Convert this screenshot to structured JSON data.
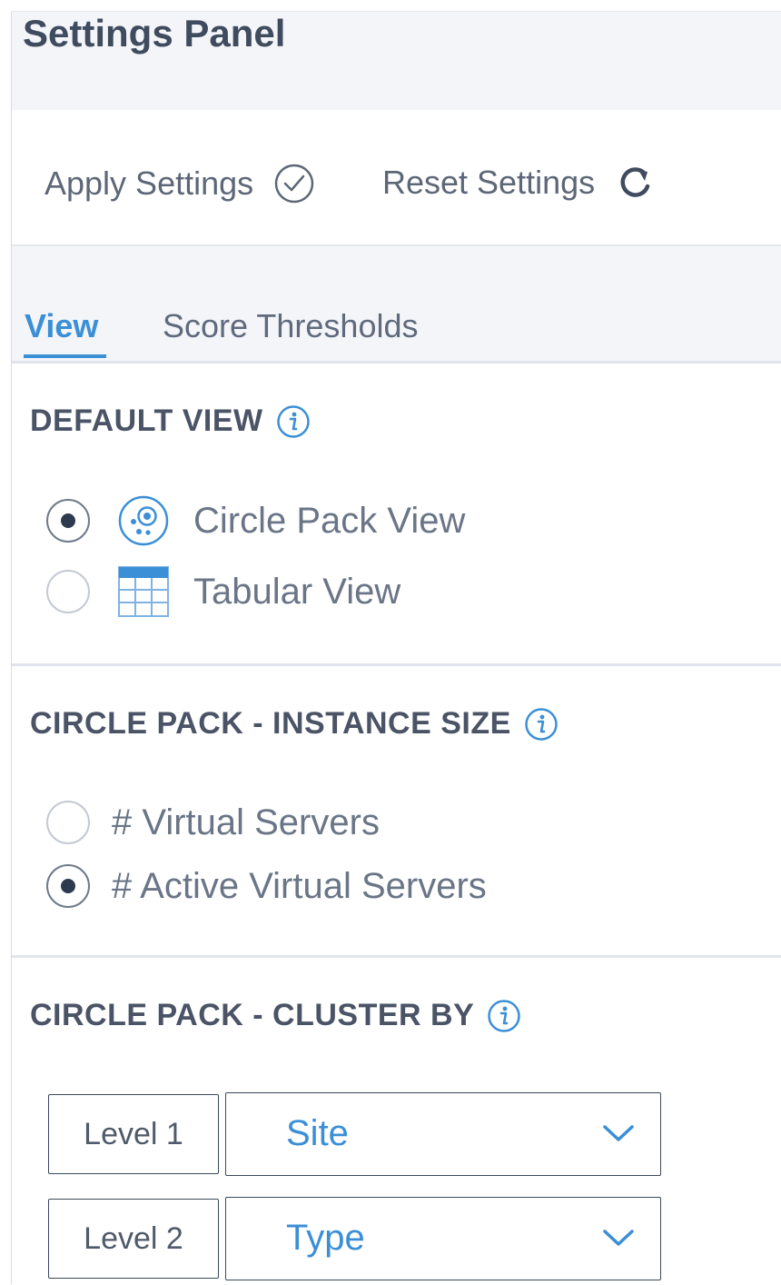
{
  "panel": {
    "title": "Settings Panel"
  },
  "toolbar": {
    "apply_label": "Apply Settings",
    "reset_label": "Reset Settings"
  },
  "tabs": [
    {
      "label": "View",
      "active": true
    },
    {
      "label": "Score Thresholds",
      "active": false
    }
  ],
  "default_view": {
    "heading": "DEFAULT VIEW",
    "options": [
      {
        "label": "Circle Pack View",
        "selected": true,
        "icon": "circle-pack-icon"
      },
      {
        "label": "Tabular View",
        "selected": false,
        "icon": "table-icon"
      }
    ]
  },
  "instance_size": {
    "heading": "CIRCLE PACK - INSTANCE SIZE",
    "options": [
      {
        "label": "# Virtual Servers",
        "selected": false
      },
      {
        "label": "# Active Virtual Servers",
        "selected": true
      }
    ]
  },
  "cluster_by": {
    "heading": "CIRCLE PACK - CLUSTER BY",
    "levels": [
      {
        "level": "Level 1",
        "value": "Site"
      },
      {
        "level": "Level 2",
        "value": "Type"
      }
    ]
  },
  "colors": {
    "accent": "#3b8fd6",
    "header_bg": "#f4f5f8",
    "text": "#5f6a7d"
  }
}
